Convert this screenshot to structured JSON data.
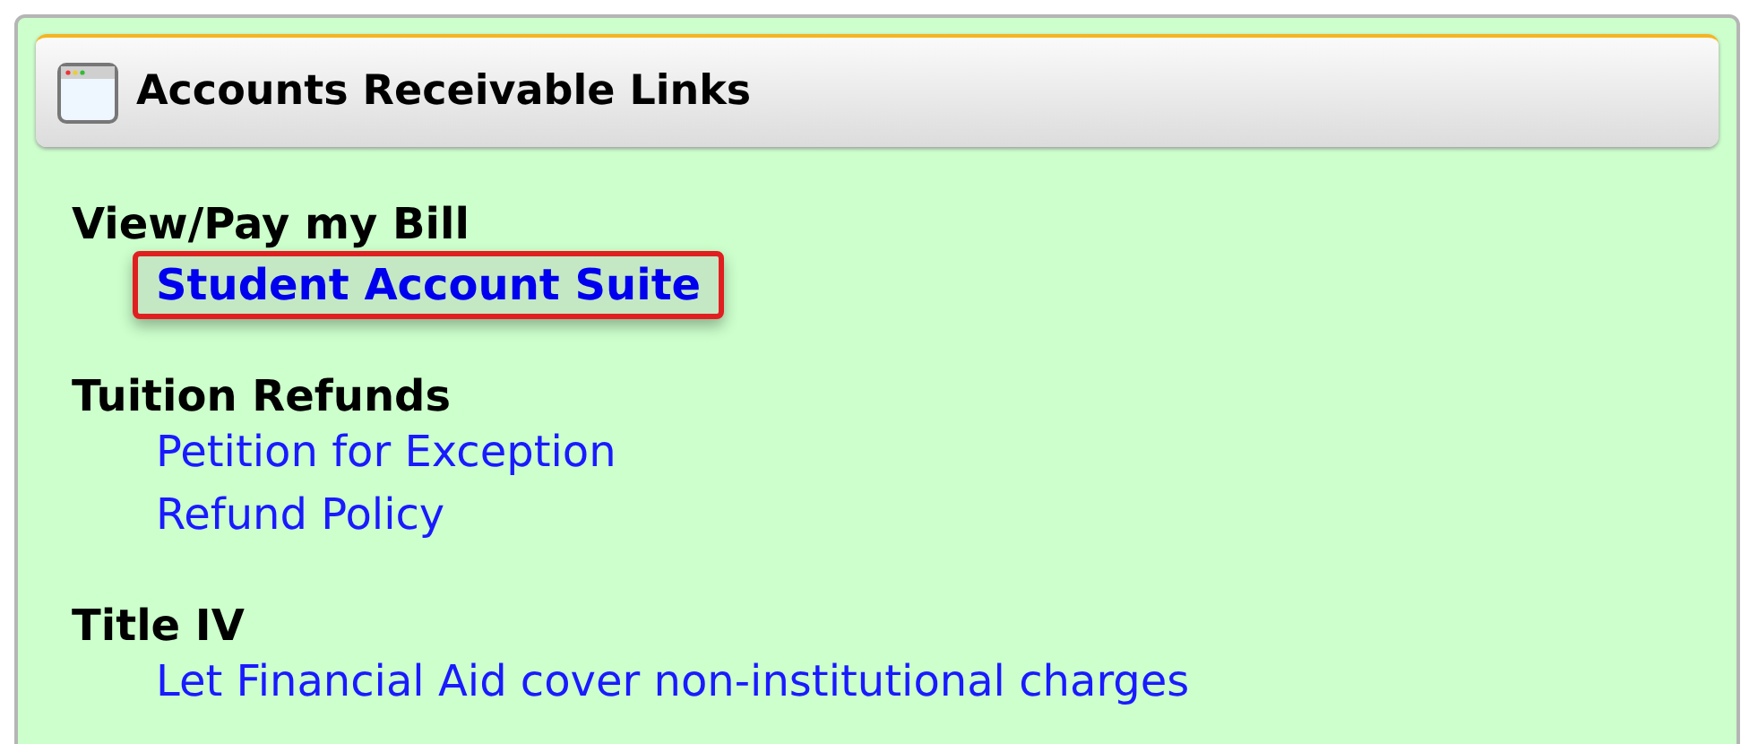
{
  "panel": {
    "title": "Accounts Receivable Links"
  },
  "sections": [
    {
      "heading": "View/Pay my Bill",
      "links": [
        {
          "label": "Student Account Suite",
          "highlighted": true
        }
      ]
    },
    {
      "heading": "Tuition Refunds",
      "links": [
        {
          "label": "Petition for Exception",
          "highlighted": false
        },
        {
          "label": "Refund Policy",
          "highlighted": false
        }
      ]
    },
    {
      "heading": "Title IV",
      "links": [
        {
          "label": "Let Financial Aid cover non-institutional charges",
          "highlighted": false
        }
      ]
    }
  ]
}
